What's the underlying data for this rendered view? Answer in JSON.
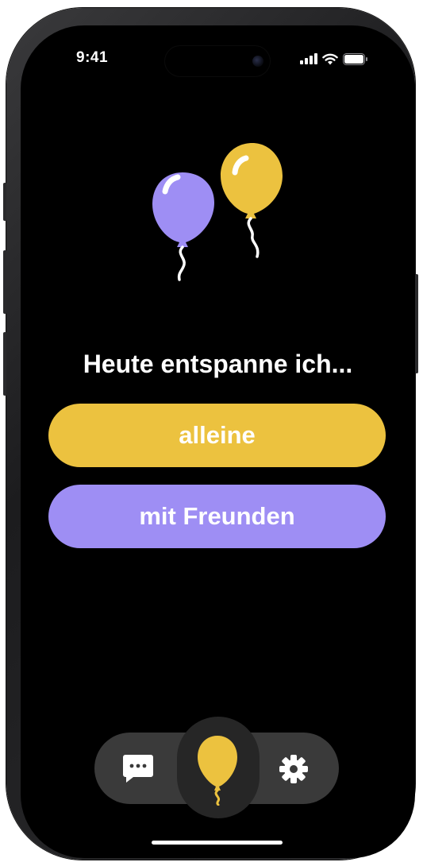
{
  "status_bar": {
    "time": "9:41",
    "signal_icon": "cellular-signal-icon",
    "wifi_icon": "wifi-icon",
    "battery_icon": "battery-icon"
  },
  "hero": {
    "illustration": "balloons-illustration",
    "balloon_colors": [
      "#9e8ef4",
      "#ecc23f"
    ]
  },
  "prompt": {
    "heading": "Heute entspanne ich..."
  },
  "choices": {
    "alone_label": "alleine",
    "friends_label": "mit Freunden"
  },
  "tabbar": {
    "items": [
      {
        "icon": "chat-bubble-icon",
        "active": false
      },
      {
        "icon": "balloon-icon",
        "active": true
      },
      {
        "icon": "gear-icon",
        "active": false
      }
    ]
  },
  "colors": {
    "background": "#000000",
    "accent_yellow": "#ecc23f",
    "accent_purple": "#9e8ef4",
    "tabbar": "#3a3a3a"
  }
}
